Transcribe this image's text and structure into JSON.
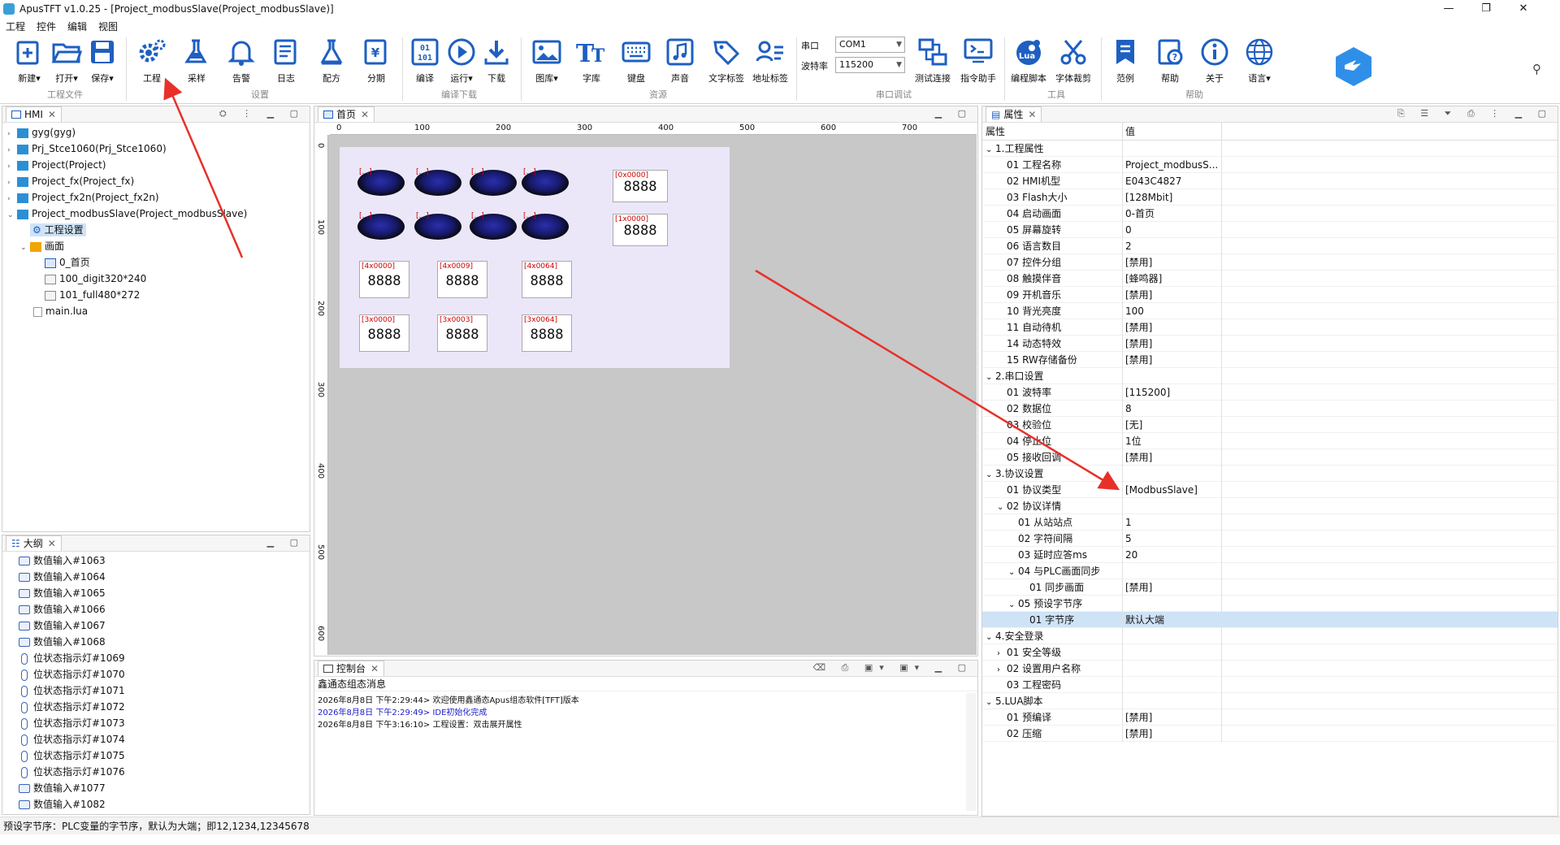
{
  "window": {
    "title": "ApusTFT v1.0.25 - [Project_modbusSlave(Project_modbusSlave)]",
    "min": "—",
    "max": "❐",
    "close": "✕"
  },
  "menu": [
    "工程",
    "控件",
    "编辑",
    "视图"
  ],
  "ribbon": {
    "buttons": [
      "新建",
      "打开",
      "保存",
      "工程",
      "采样",
      "告警",
      "日志",
      "配方",
      "分期",
      "编译",
      "运行",
      "下载",
      "图库",
      "字库",
      "键盘",
      "声音",
      "文字标签",
      "地址标签",
      "测试连接",
      "指令助手",
      "编程脚本",
      "字体裁剪",
      "范例",
      "帮助",
      "关于",
      "语言"
    ],
    "groups": [
      "工程文件",
      "设置",
      "编译下载",
      "资源",
      "串口调试",
      "工具",
      "帮助"
    ],
    "serial": {
      "port_label": "串口",
      "port_value": "COM1",
      "baud_label": "波特率",
      "baud_value": "115200"
    },
    "icon_text": {
      "lua": "Lua",
      "binary": "01\n101",
      "font": "T"
    }
  },
  "hmi_panel": {
    "tab": "HMI",
    "items": [
      "gyg(gyg)",
      "Prj_Stce1060(Prj_Stce1060)",
      "Project(Project)",
      "Project_fx(Project_fx)",
      "Project_fx2n(Project_fx2n)",
      "Project_modbusSlave(Project_modbusSlave)",
      "工程设置",
      "画面",
      "0_首页",
      "100_digit320*240",
      "101_full480*272",
      "main.lua"
    ]
  },
  "outline_panel": {
    "tab": "大纲",
    "items": [
      "数值输入#1063",
      "数值输入#1064",
      "数值输入#1065",
      "数值输入#1066",
      "数值输入#1067",
      "数值输入#1068",
      "位状态指示灯#1069",
      "位状态指示灯#1070",
      "位状态指示灯#1071",
      "位状态指示灯#1072",
      "位状态指示灯#1073",
      "位状态指示灯#1074",
      "位状态指示灯#1075",
      "位状态指示灯#1076",
      "数值输入#1077",
      "数值输入#1082"
    ]
  },
  "editor": {
    "tab": "首页",
    "ruler_top": [
      "0",
      "100",
      "200",
      "300",
      "400",
      "500",
      "600",
      "700"
    ],
    "ruler_left": [
      "0",
      "100",
      "200",
      "300",
      "400",
      "500",
      "600"
    ],
    "lamp_label": "[...]",
    "numbers": [
      {
        "addr": "[0x0000]",
        "val": "8888"
      },
      {
        "addr": "[1x0000]",
        "val": "8888"
      },
      {
        "addr": "[4x0000]",
        "val": "8888"
      },
      {
        "addr": "[4x0009]",
        "val": "8888"
      },
      {
        "addr": "[4x0064]",
        "val": "8888"
      },
      {
        "addr": "[3x0000]",
        "val": "8888"
      },
      {
        "addr": "[3x0003]",
        "val": "8888"
      },
      {
        "addr": "[3x0064]",
        "val": "8888"
      }
    ]
  },
  "console": {
    "tab": "控制台",
    "header": "鑫通态组态消息",
    "lines": [
      {
        "text": "2026年8月8日 下午2:29:44> 欢迎使用鑫通态Apus组态软件[TFT]版本",
        "color": "#111111"
      },
      {
        "text": "2026年8月8日 下午2:29:49> IDE初始化完成",
        "color": "#1a1acc"
      },
      {
        "text": "2026年8月8日 下午3:16:10> 工程设置：双击展开属性",
        "color": "#111111"
      }
    ]
  },
  "properties": {
    "tab": "属性",
    "col_key": "属性",
    "col_val": "值",
    "rows": [
      {
        "k": "1.工程属性",
        "v": "",
        "lvl": 0,
        "tw": "⌄"
      },
      {
        "k": "01 工程名称",
        "v": "Project_modbusS...",
        "lvl": 1,
        "tw": ""
      },
      {
        "k": "02 HMI机型",
        "v": "E043C4827",
        "lvl": 1,
        "tw": ""
      },
      {
        "k": "03 Flash大小",
        "v": "[128Mbit]",
        "lvl": 1,
        "tw": ""
      },
      {
        "k": "04 启动画面",
        "v": "0-首页",
        "lvl": 1,
        "tw": ""
      },
      {
        "k": "05 屏幕旋转",
        "v": "0",
        "lvl": 1,
        "tw": ""
      },
      {
        "k": "06 语言数目",
        "v": "2",
        "lvl": 1,
        "tw": ""
      },
      {
        "k": "07 控件分组",
        "v": "[禁用]",
        "lvl": 1,
        "tw": ""
      },
      {
        "k": "08 触摸伴音",
        "v": "[蜂鸣器]",
        "lvl": 1,
        "tw": ""
      },
      {
        "k": "09 开机音乐",
        "v": "[禁用]",
        "lvl": 1,
        "tw": ""
      },
      {
        "k": "10 背光亮度",
        "v": "100",
        "lvl": 1,
        "tw": ""
      },
      {
        "k": "11 自动待机",
        "v": "[禁用]",
        "lvl": 1,
        "tw": ""
      },
      {
        "k": "14 动态特效",
        "v": "[禁用]",
        "lvl": 1,
        "tw": ""
      },
      {
        "k": "15 RW存储备份",
        "v": "[禁用]",
        "lvl": 1,
        "tw": ""
      },
      {
        "k": "2.串口设置",
        "v": "",
        "lvl": 0,
        "tw": "⌄"
      },
      {
        "k": "01 波特率",
        "v": "[115200]",
        "lvl": 1,
        "tw": ""
      },
      {
        "k": "02 数据位",
        "v": "8",
        "lvl": 1,
        "tw": ""
      },
      {
        "k": "03 校验位",
        "v": "[无]",
        "lvl": 1,
        "tw": ""
      },
      {
        "k": "04 停止位",
        "v": "1位",
        "lvl": 1,
        "tw": ""
      },
      {
        "k": "05 接收回调",
        "v": "[禁用]",
        "lvl": 1,
        "tw": ""
      },
      {
        "k": "3.协议设置",
        "v": "",
        "lvl": 0,
        "tw": "⌄"
      },
      {
        "k": "01 协议类型",
        "v": "[ModbusSlave]",
        "lvl": 1,
        "tw": ""
      },
      {
        "k": "02 协议详情",
        "v": "",
        "lvl": 1,
        "tw": "⌄"
      },
      {
        "k": "01 从站站点",
        "v": "1",
        "lvl": 2,
        "tw": ""
      },
      {
        "k": "02 字符间隔",
        "v": "5",
        "lvl": 2,
        "tw": ""
      },
      {
        "k": "03 延时应答ms",
        "v": "20",
        "lvl": 2,
        "tw": ""
      },
      {
        "k": "04 与PLC画面同步",
        "v": "",
        "lvl": 2,
        "tw": "⌄"
      },
      {
        "k": "01 同步画面",
        "v": "[禁用]",
        "lvl": 3,
        "tw": ""
      },
      {
        "k": "05 预设字节序",
        "v": "",
        "lvl": 2,
        "tw": "⌄"
      },
      {
        "k": "01 字节序",
        "v": "默认大端",
        "lvl": 3,
        "tw": "",
        "selected": true
      },
      {
        "k": "4.安全登录",
        "v": "",
        "lvl": 0,
        "tw": "⌄"
      },
      {
        "k": "01 安全等级",
        "v": "",
        "lvl": 1,
        "tw": "›"
      },
      {
        "k": "02 设置用户名称",
        "v": "",
        "lvl": 1,
        "tw": "›"
      },
      {
        "k": "03 工程密码",
        "v": "",
        "lvl": 1,
        "tw": ""
      },
      {
        "k": "5.LUA脚本",
        "v": "",
        "lvl": 0,
        "tw": "⌄"
      },
      {
        "k": "01 预编译",
        "v": "[禁用]",
        "lvl": 1,
        "tw": ""
      },
      {
        "k": "02 压缩",
        "v": "[禁用]",
        "lvl": 1,
        "tw": ""
      }
    ]
  },
  "status": "预设字节序：PLC变量的字节序，默认为大端；即12,1234,12345678",
  "colors": {
    "accent": "#1e5fc2",
    "arrow": "#e8302a",
    "selection": "#cfe3f7"
  }
}
